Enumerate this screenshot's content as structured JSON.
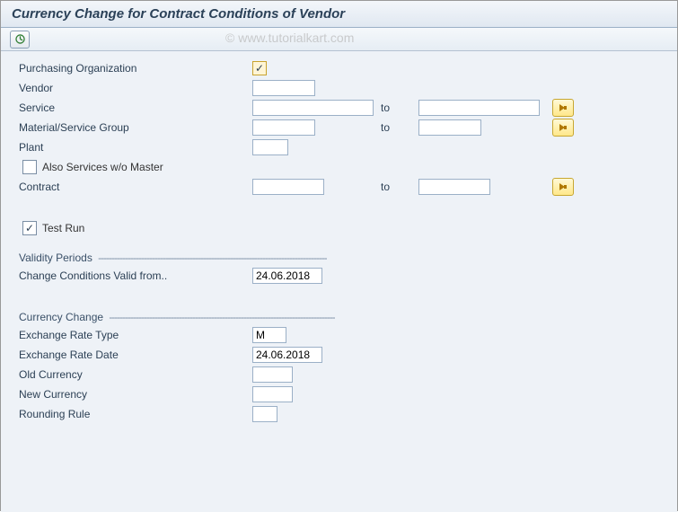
{
  "title": "Currency Change for Contract Conditions of Vendor",
  "watermark": "© www.tutorialkart.com",
  "toolbar": {
    "execute_tooltip": "Execute"
  },
  "selection": {
    "purch_org_label": "Purchasing Organization",
    "purch_org_value": "",
    "purch_org_checked": true,
    "vendor_label": "Vendor",
    "vendor_value": "",
    "service_label": "Service",
    "service_from": "",
    "service_to": "",
    "matgrp_label": "Material/Service Group",
    "matgrp_from": "",
    "matgrp_to": "",
    "plant_label": "Plant",
    "plant_value": "",
    "also_services_label": "Also Services w/o Master",
    "also_services_checked": false,
    "contract_label": "Contract",
    "contract_from": "",
    "contract_to": "",
    "to_label": "to"
  },
  "testrun": {
    "label": "Test Run",
    "checked": true
  },
  "validity": {
    "group": "Validity Periods",
    "change_from_label": "Change Conditions Valid from..",
    "change_from_value": "24.06.2018"
  },
  "currency": {
    "group": "Currency Change",
    "rate_type_label": "Exchange Rate Type",
    "rate_type_value": "M",
    "rate_date_label": "Exchange Rate Date",
    "rate_date_value": "24.06.2018",
    "old_curr_label": "Old Currency",
    "old_curr_value": "",
    "new_curr_label": "New Currency",
    "new_curr_value": "",
    "rounding_label": "Rounding Rule",
    "rounding_value": ""
  }
}
